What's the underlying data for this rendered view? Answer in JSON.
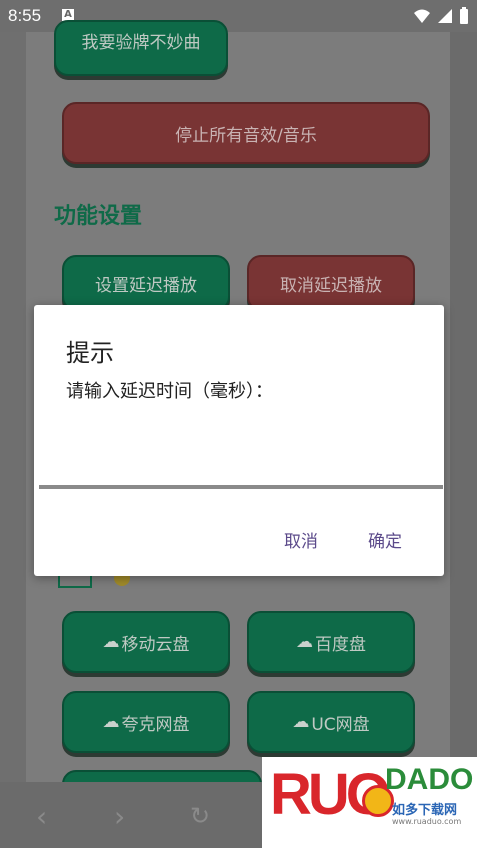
{
  "status": {
    "time": "8:55",
    "app_indicator": "A"
  },
  "buttons": {
    "top_partial": "我要验牌不妙曲",
    "stop_all": "停止所有音效/音乐",
    "set_delay": "设置延迟播放",
    "cancel_delay": "取消延迟播放",
    "cloud_mobile": "移动云盘",
    "cloud_baidu": "百度盘",
    "cloud_quark": "夸克网盘",
    "cloud_uc": "UC网盘"
  },
  "section": {
    "title": "功能设置"
  },
  "dialog": {
    "title": "提示",
    "message": "请输入延迟时间（毫秒）：",
    "input_value": "",
    "cancel": "取消",
    "confirm": "确定"
  },
  "watermark": {
    "brand_left": "RUO",
    "brand_right": "DADO",
    "cn": "如多下载网",
    "url": "www.ruaduo.com"
  },
  "colors": {
    "accent_green": "#0e6a48",
    "accent_red": "#793434",
    "dialog_button": "#5b4a8a"
  }
}
